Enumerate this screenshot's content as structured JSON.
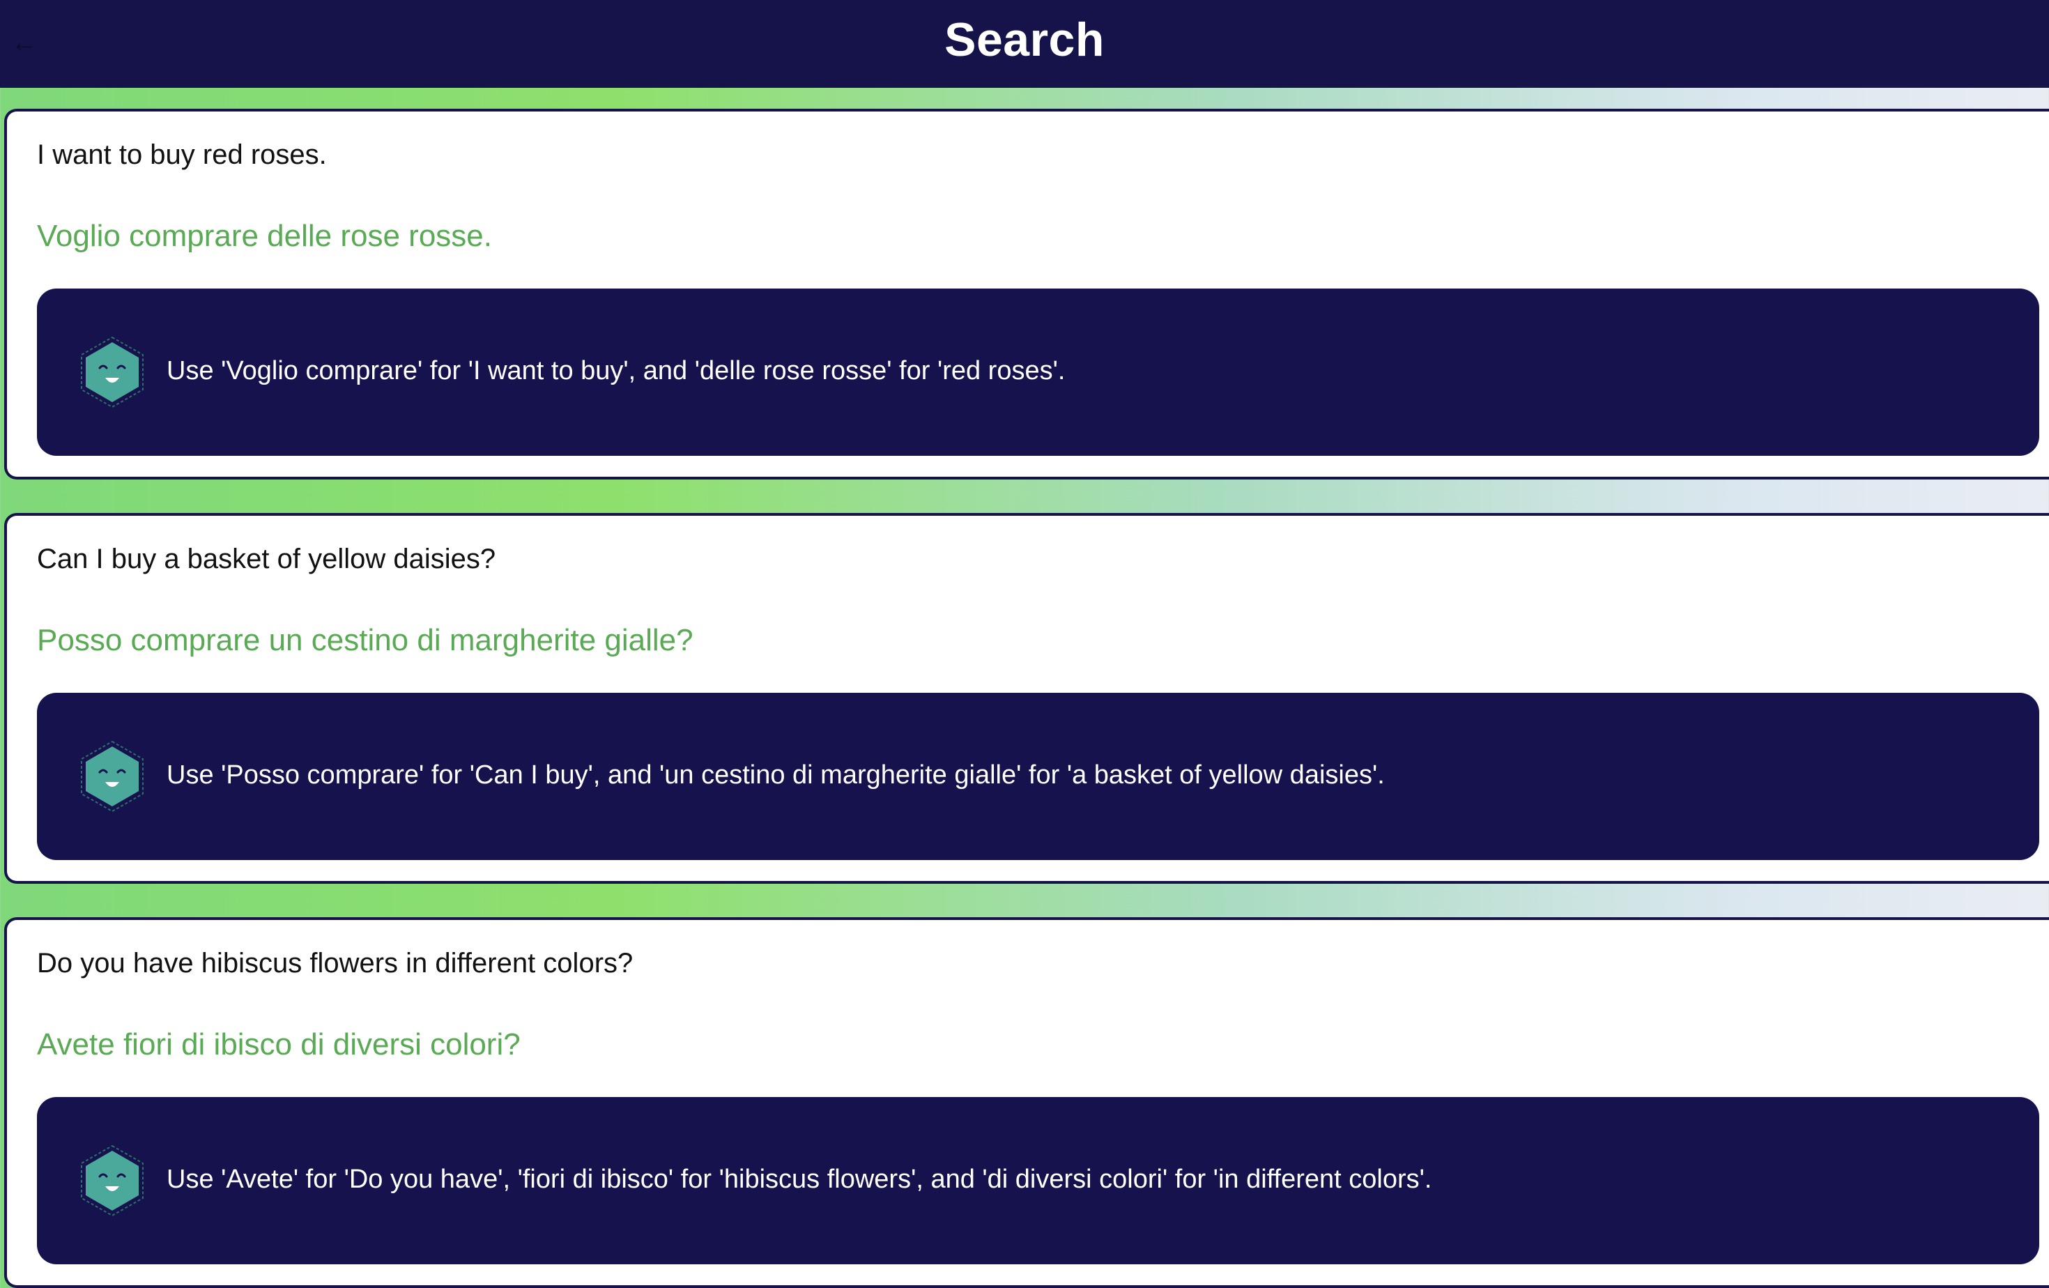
{
  "header": {
    "title": "Search",
    "back_icon": "arrow-left-icon"
  },
  "colors": {
    "header_bg": "#15134a",
    "tip_bg": "#15124d",
    "translation_text": "#5aaa55",
    "mascot_face": "#4aa99a"
  },
  "results": [
    {
      "english": "I want to buy red roses.",
      "italian": "Voglio comprare delle rose rosse.",
      "tip": "Use 'Voglio comprare' for 'I want to buy', and 'delle rose rosse' for 'red roses'."
    },
    {
      "english": "Can I buy a basket of yellow daisies?",
      "italian": "Posso comprare un cestino di margherite gialle?",
      "tip": "Use 'Posso comprare' for 'Can I buy', and 'un cestino di margherite gialle' for 'a basket of yellow daisies'."
    },
    {
      "english": "Do you have hibiscus flowers in different colors?",
      "italian": "Avete fiori di ibisco di diversi colori?",
      "tip": "Use 'Avete' for 'Do you have', 'fiori di ibisco' for 'hibiscus flowers', and 'di diversi colori' for 'in different colors'."
    }
  ]
}
